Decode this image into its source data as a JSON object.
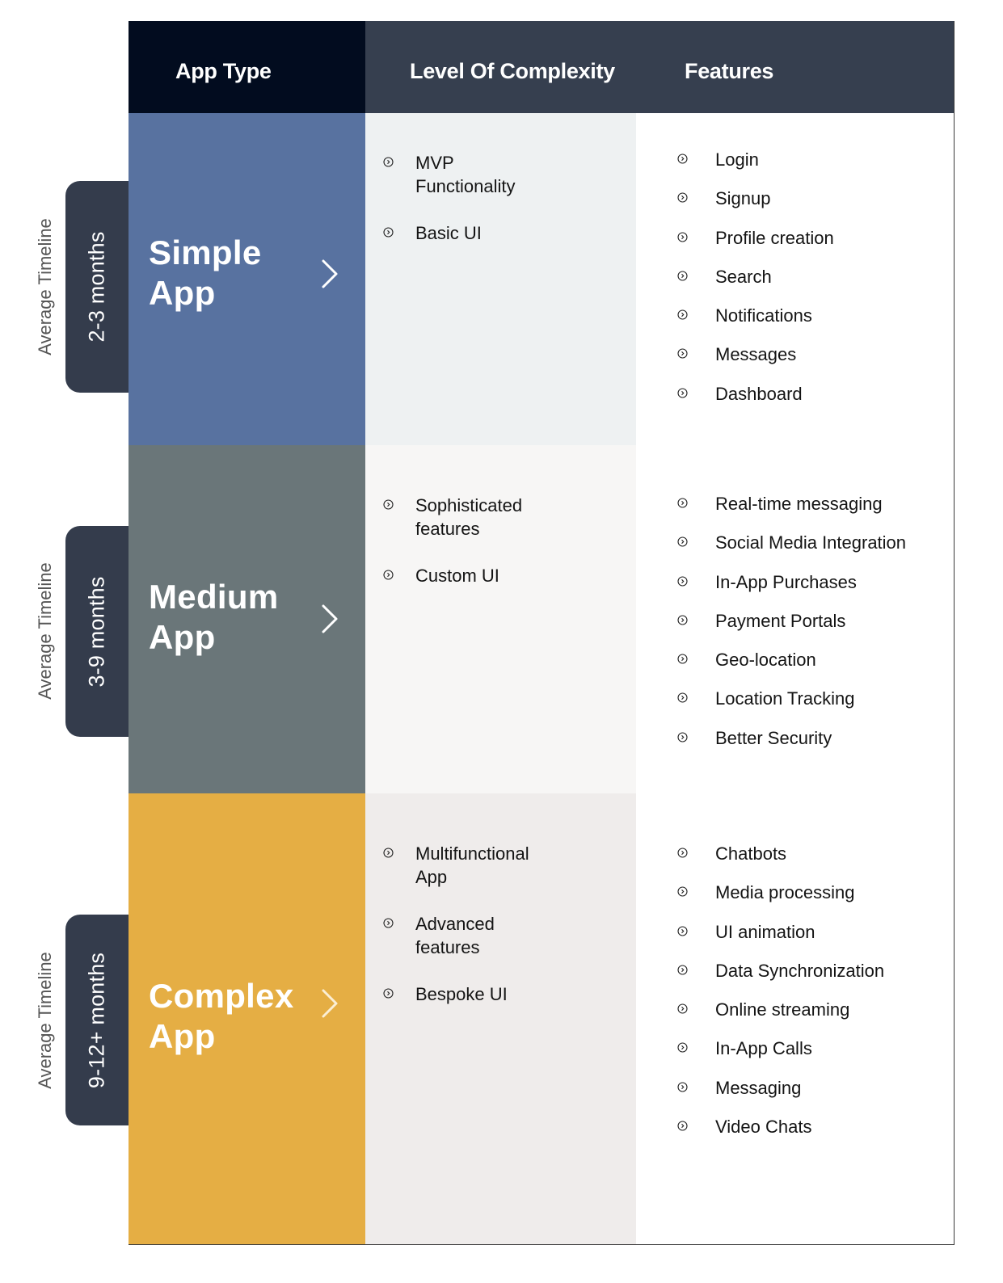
{
  "colors": {
    "header_bg": "#363f4f",
    "header_apptype_bg": "#020c1f",
    "timeline_tab_bg": "#343c4c",
    "simple_bg": "#5872a0",
    "medium_bg": "#6a7679",
    "complex_bg": "#e5ae44",
    "simple_complexity_bg": "#eef1f2",
    "medium_complexity_bg": "#f7f6f5",
    "complex_complexity_bg": "#efeceb"
  },
  "header": {
    "app_type": "App Type",
    "complexity": "Level Of Complexity",
    "features": "Features"
  },
  "timeline_label": "Average Timeline",
  "rows": [
    {
      "title_line1": "Simple",
      "title_line2": "App",
      "timeline": "2-3 months",
      "complexity": [
        "MVP Functionality",
        "Basic UI"
      ],
      "features": [
        "Login",
        "Signup",
        "Profile creation",
        "Search",
        "Notifications",
        "Messages",
        "Dashboard"
      ]
    },
    {
      "title_line1": "Medium",
      "title_line2": "App",
      "timeline": "3-9 months",
      "complexity": [
        "Sophisticated features",
        "Custom UI"
      ],
      "features": [
        "Real-time messaging",
        "Social Media Integration",
        "In-App Purchases",
        "Payment Portals",
        "Geo-location",
        "Location Tracking",
        "Better Security"
      ]
    },
    {
      "title_line1": "Complex",
      "title_line2": "App",
      "timeline": "9-12+ months",
      "complexity": [
        "Multifunctional App",
        "Advanced features",
        "Bespoke UI"
      ],
      "features": [
        "Chatbots",
        "Media processing",
        "UI animation",
        "Data Synchronization",
        "Online streaming",
        "In-App Calls",
        "Messaging",
        "Video Chats"
      ]
    }
  ]
}
